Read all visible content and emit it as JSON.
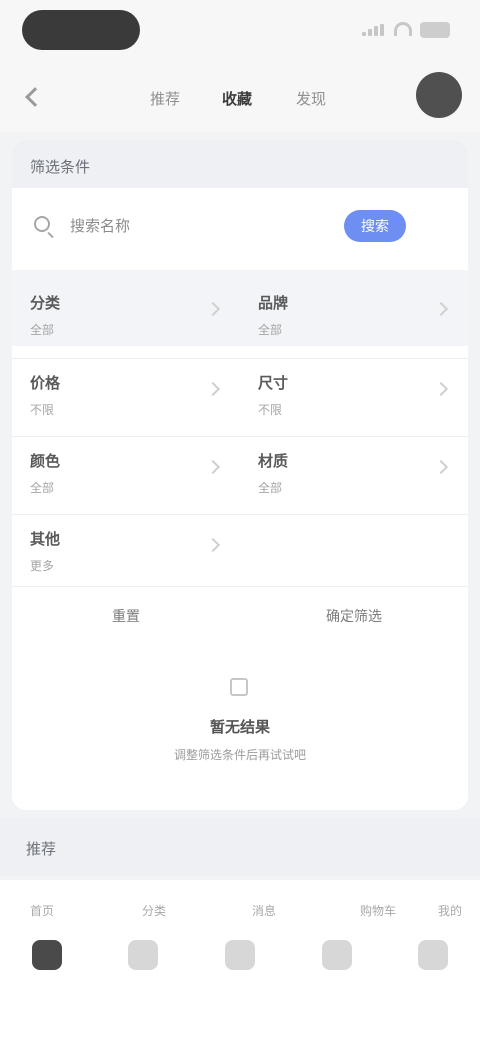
{
  "status_bar": {
    "icons": [
      "signal-icon",
      "wifi-icon",
      "battery-icon"
    ]
  },
  "top_nav": {
    "tabs": [
      {
        "label": "推荐"
      },
      {
        "label": "收藏"
      },
      {
        "label": "发现"
      }
    ]
  },
  "card": {
    "header_label": "筛选条件",
    "search": {
      "placeholder": "搜索名称",
      "button_label": "搜索"
    },
    "grid": [
      {
        "name": "分类",
        "sub": "全部"
      },
      {
        "name": "品牌",
        "sub": "全部"
      },
      {
        "name": "价格",
        "sub": "不限"
      },
      {
        "name": "尺寸",
        "sub": "不限"
      },
      {
        "name": "颜色",
        "sub": "全部"
      },
      {
        "name": "材质",
        "sub": "全部"
      },
      {
        "name": "其他",
        "sub": "更多"
      }
    ],
    "actions": [
      {
        "label": "重置"
      },
      {
        "label": "确定筛选"
      }
    ],
    "empty_state": {
      "title": "暂无结果",
      "description": "调整筛选条件后再试试吧"
    }
  },
  "section": {
    "label": "推荐"
  },
  "tab_bar": {
    "labels": [
      "首页",
      "分类",
      "消息",
      "购物车",
      "我的"
    ]
  },
  "colors": {
    "accent": "#6f8ef1",
    "background": "#f2f3f5"
  }
}
